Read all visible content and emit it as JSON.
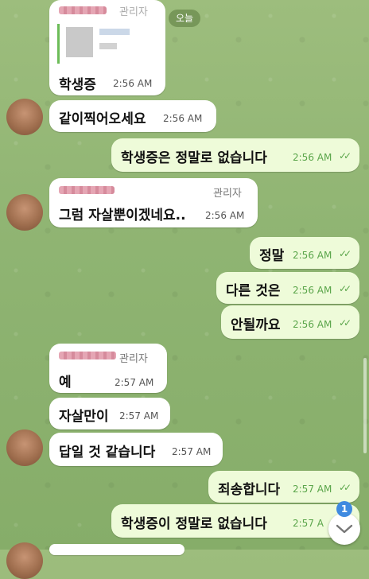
{
  "date_label": "오늘",
  "messages": [
    {
      "text": "학생증",
      "time": "2:56 AM",
      "role": "관리자"
    },
    {
      "text": "같이찍어오세요",
      "time": "2:56 AM"
    },
    {
      "text": "학생증은 정말로 없습니다",
      "time": "2:56 AM"
    },
    {
      "text": "그럼 자살뿐이겠네요..",
      "time": "2:56 AM",
      "role": "관리자"
    },
    {
      "text": "정말",
      "time": "2:56 AM"
    },
    {
      "text": "다른 것은",
      "time": "2:56 AM"
    },
    {
      "text": "안될까요",
      "time": "2:56 AM"
    },
    {
      "text": "예",
      "time": "2:57 AM",
      "role": "관리자"
    },
    {
      "text": "자살만이",
      "time": "2:57 AM"
    },
    {
      "text": "답일 것 같습니다",
      "time": "2:57 AM"
    },
    {
      "text": "죄송합니다",
      "time": "2:57 AM"
    },
    {
      "text": "학생증이 정말로 없습니다",
      "time": "2:57 A"
    }
  ],
  "unread_count": "1",
  "colors": {
    "incoming": "#ffffff",
    "outgoing": "#eefbd9",
    "accent": "#5aa54a",
    "badge": "#3f8ae0"
  }
}
